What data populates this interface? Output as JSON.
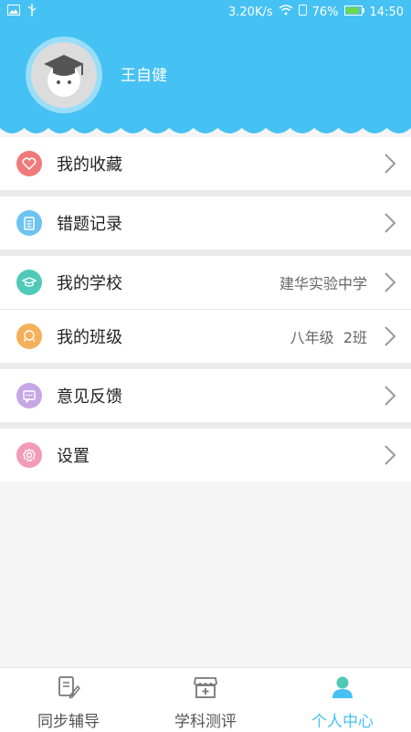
{
  "status_bar": {
    "speed": "3.20K/s",
    "battery": "76%",
    "time": "14:50"
  },
  "profile": {
    "name": "王自健"
  },
  "menu": [
    {
      "label": "我的收藏",
      "value": "",
      "icon": "heart-icon",
      "color": "#f07a7a"
    },
    {
      "label": "错题记录",
      "value": "",
      "icon": "clipboard-icon",
      "color": "#6cc3f0"
    },
    {
      "label": "我的学校",
      "value": "建华实验中学",
      "icon": "graduation-cap-icon",
      "color": "#4fc9b8"
    },
    {
      "label": "我的班级",
      "value": "八年级  2班",
      "icon": "group-icon",
      "color": "#f4b05a"
    },
    {
      "label": "意见反馈",
      "value": "",
      "icon": "chat-icon",
      "color": "#c7a6e6"
    },
    {
      "label": "设置",
      "value": "",
      "icon": "gear-icon",
      "color": "#f29bb6"
    }
  ],
  "tabs": [
    {
      "label": "同步辅导",
      "icon": "book-edit-icon",
      "active": false
    },
    {
      "label": "学科测评",
      "icon": "store-icon",
      "active": false
    },
    {
      "label": "个人中心",
      "icon": "person-icon",
      "active": true
    }
  ],
  "colors": {
    "primary": "#45c1f3",
    "background": "#f5f5f5"
  }
}
